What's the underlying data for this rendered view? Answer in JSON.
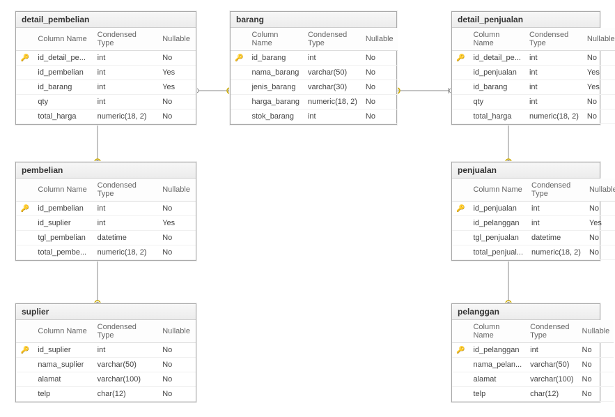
{
  "headers": {
    "column_name": "Column Name",
    "condensed_type": "Condensed Type",
    "nullable": "Nullable"
  },
  "tables": {
    "detail_pembelian": {
      "title": "detail_pembelian",
      "rows": [
        {
          "pk": true,
          "name": "id_detail_pe...",
          "type": "int",
          "nullable": "No"
        },
        {
          "pk": false,
          "name": "id_pembelian",
          "type": "int",
          "nullable": "Yes"
        },
        {
          "pk": false,
          "name": "id_barang",
          "type": "int",
          "nullable": "Yes"
        },
        {
          "pk": false,
          "name": "qty",
          "type": "int",
          "nullable": "No"
        },
        {
          "pk": false,
          "name": "total_harga",
          "type": "numeric(18, 2)",
          "nullable": "No"
        }
      ]
    },
    "barang": {
      "title": "barang",
      "rows": [
        {
          "pk": true,
          "name": "id_barang",
          "type": "int",
          "nullable": "No"
        },
        {
          "pk": false,
          "name": "nama_barang",
          "type": "varchar(50)",
          "nullable": "No"
        },
        {
          "pk": false,
          "name": "jenis_barang",
          "type": "varchar(30)",
          "nullable": "No"
        },
        {
          "pk": false,
          "name": "harga_barang",
          "type": "numeric(18, 2)",
          "nullable": "No"
        },
        {
          "pk": false,
          "name": "stok_barang",
          "type": "int",
          "nullable": "No"
        }
      ]
    },
    "detail_penjualan": {
      "title": "detail_penjualan",
      "rows": [
        {
          "pk": true,
          "name": "id_detail_pe...",
          "type": "int",
          "nullable": "No"
        },
        {
          "pk": false,
          "name": "id_penjualan",
          "type": "int",
          "nullable": "Yes"
        },
        {
          "pk": false,
          "name": "id_barang",
          "type": "int",
          "nullable": "Yes"
        },
        {
          "pk": false,
          "name": "qty",
          "type": "int",
          "nullable": "No"
        },
        {
          "pk": false,
          "name": "total_harga",
          "type": "numeric(18, 2)",
          "nullable": "No"
        }
      ]
    },
    "pembelian": {
      "title": "pembelian",
      "rows": [
        {
          "pk": true,
          "name": "id_pembelian",
          "type": "int",
          "nullable": "No"
        },
        {
          "pk": false,
          "name": "id_suplier",
          "type": "int",
          "nullable": "Yes"
        },
        {
          "pk": false,
          "name": "tgl_pembelian",
          "type": "datetime",
          "nullable": "No"
        },
        {
          "pk": false,
          "name": "total_pembe...",
          "type": "numeric(18, 2)",
          "nullable": "No"
        }
      ]
    },
    "penjualan": {
      "title": "penjualan",
      "rows": [
        {
          "pk": true,
          "name": "id_penjualan",
          "type": "int",
          "nullable": "No"
        },
        {
          "pk": false,
          "name": "id_pelanggan",
          "type": "int",
          "nullable": "Yes"
        },
        {
          "pk": false,
          "name": "tgl_penjualan",
          "type": "datetime",
          "nullable": "No"
        },
        {
          "pk": false,
          "name": "total_penjual...",
          "type": "numeric(18, 2)",
          "nullable": "No"
        }
      ]
    },
    "suplier": {
      "title": "suplier",
      "rows": [
        {
          "pk": true,
          "name": "id_suplier",
          "type": "int",
          "nullable": "No"
        },
        {
          "pk": false,
          "name": "nama_suplier",
          "type": "varchar(50)",
          "nullable": "No"
        },
        {
          "pk": false,
          "name": "alamat",
          "type": "varchar(100)",
          "nullable": "No"
        },
        {
          "pk": false,
          "name": "telp",
          "type": "char(12)",
          "nullable": "No"
        }
      ]
    },
    "pelanggan": {
      "title": "pelanggan",
      "rows": [
        {
          "pk": true,
          "name": "id_pelanggan",
          "type": "int",
          "nullable": "No"
        },
        {
          "pk": false,
          "name": "nama_pelan...",
          "type": "varchar(50)",
          "nullable": "No"
        },
        {
          "pk": false,
          "name": "alamat",
          "type": "varchar(100)",
          "nullable": "No"
        },
        {
          "pk": false,
          "name": "telp",
          "type": "char(12)",
          "nullable": "No"
        }
      ]
    }
  },
  "chart_data": {
    "type": "table",
    "description": "Entity-Relationship Diagram",
    "entities": [
      "detail_pembelian",
      "barang",
      "detail_penjualan",
      "pembelian",
      "penjualan",
      "suplier",
      "pelanggan"
    ],
    "relationships": [
      {
        "from": "detail_pembelian",
        "to": "barang",
        "via": "id_barang"
      },
      {
        "from": "detail_penjualan",
        "to": "barang",
        "via": "id_barang"
      },
      {
        "from": "detail_pembelian",
        "to": "pembelian",
        "via": "id_pembelian"
      },
      {
        "from": "detail_penjualan",
        "to": "penjualan",
        "via": "id_penjualan"
      },
      {
        "from": "pembelian",
        "to": "suplier",
        "via": "id_suplier"
      },
      {
        "from": "penjualan",
        "to": "pelanggan",
        "via": "id_pelanggan"
      }
    ]
  }
}
